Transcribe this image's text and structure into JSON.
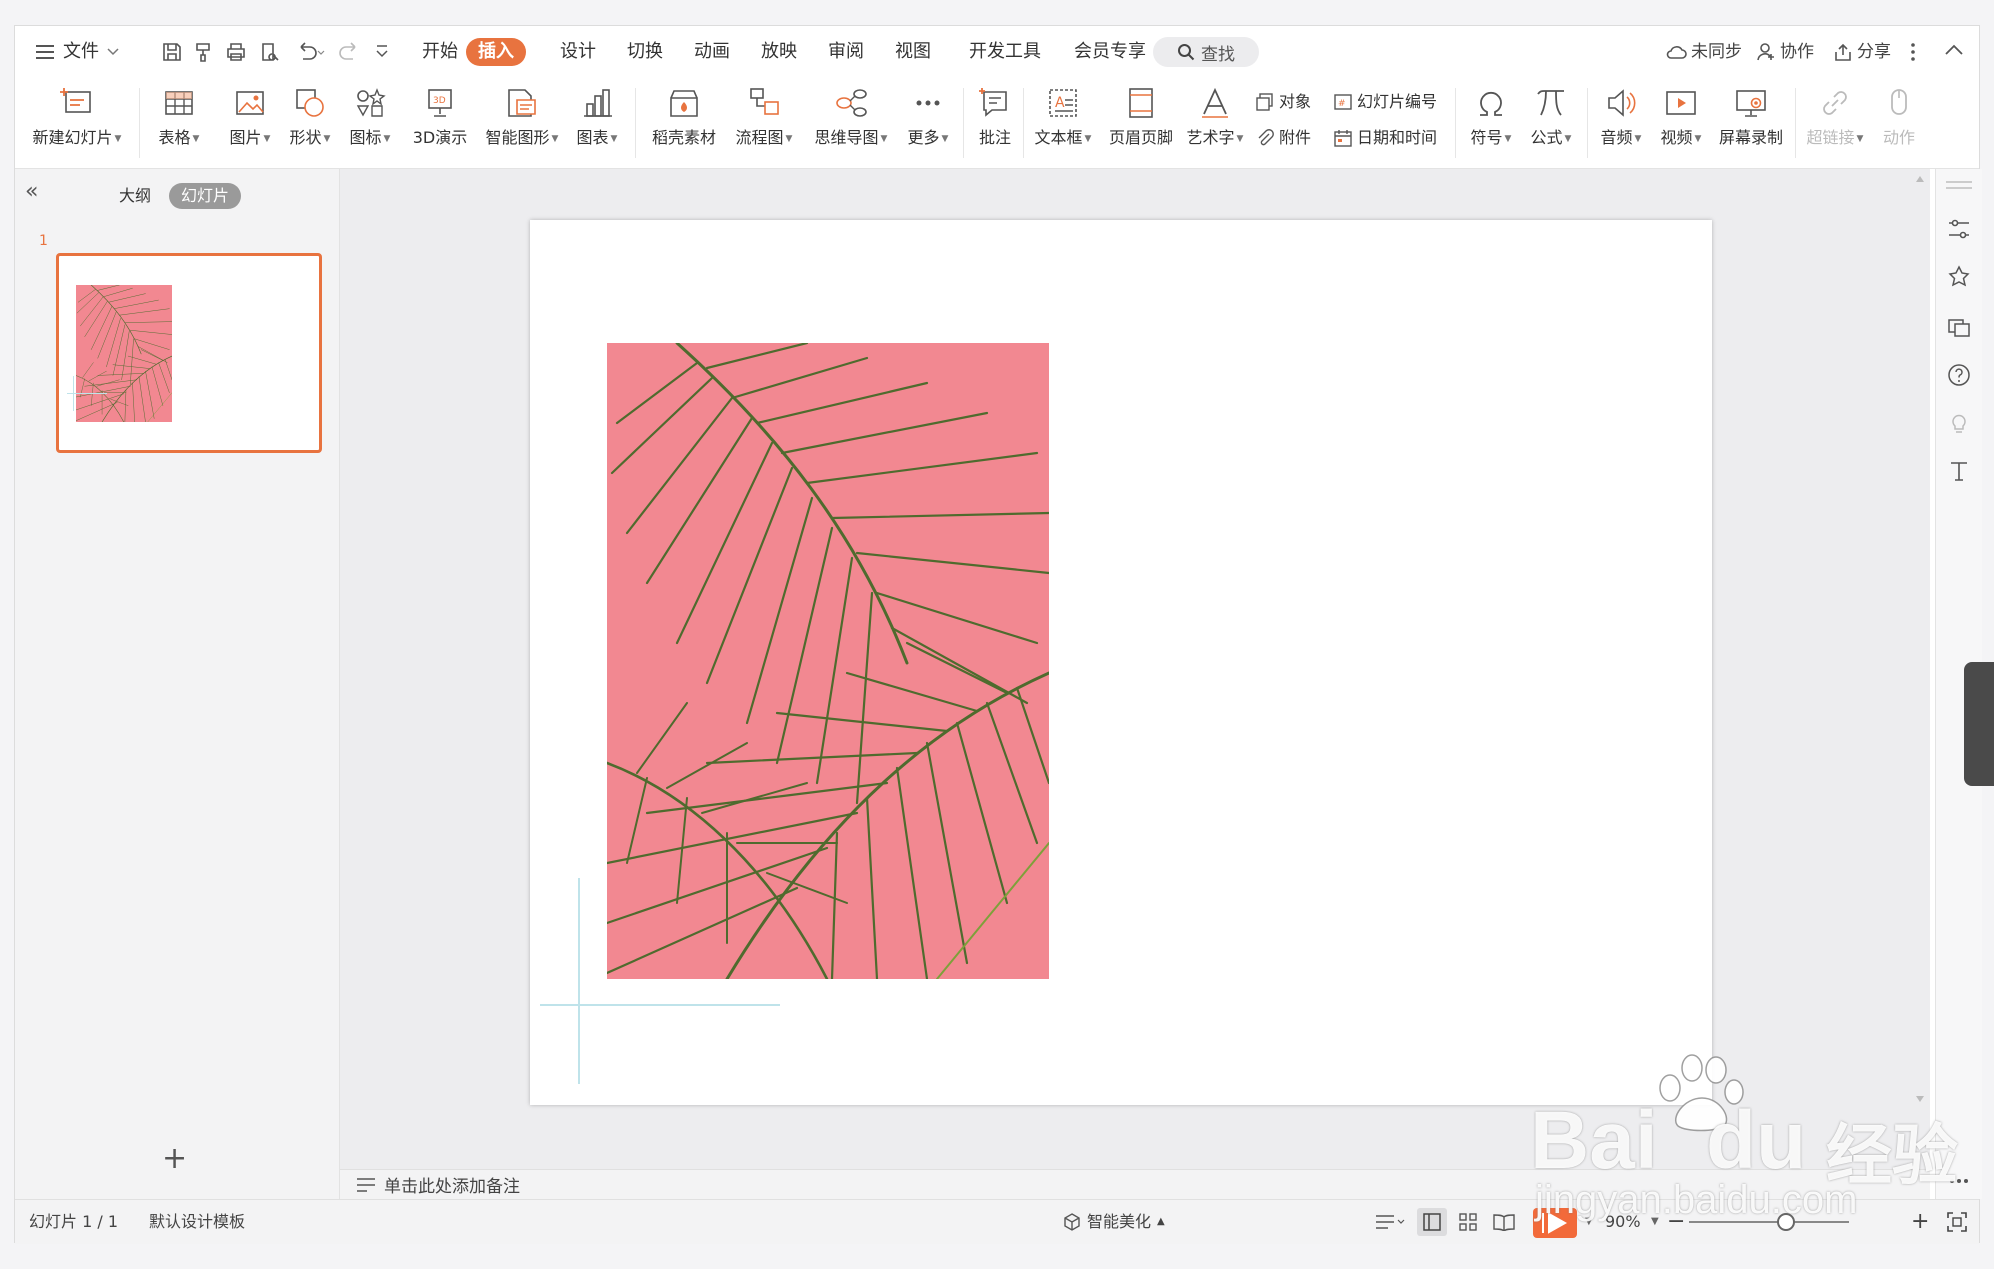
{
  "menu": {
    "file": "文件",
    "tabs": [
      "开始",
      "插入",
      "设计",
      "切换",
      "动画",
      "放映",
      "审阅",
      "视图",
      "开发工具",
      "会员专享"
    ],
    "active_tab": "插入",
    "search": "查找",
    "sync": "未同步",
    "collab": "协作",
    "share": "分享"
  },
  "ribbon": {
    "new_slide": "新建幻灯片",
    "table": "表格",
    "picture": "图片",
    "shape": "形状",
    "icon": "图标",
    "demo3d": "3D演示",
    "smartart": "智能图形",
    "chart": "图表",
    "material": "稻壳素材",
    "flowchart": "流程图",
    "mindmap": "思维导图",
    "more": "更多",
    "comment": "批注",
    "textbox": "文本框",
    "header_footer": "页眉页脚",
    "wordart": "艺术字",
    "object": "对象",
    "slide_number": "幻灯片编号",
    "attachment": "附件",
    "datetime": "日期和时间",
    "symbol": "符号",
    "formula": "公式",
    "audio": "音频",
    "video": "视频",
    "screen_record": "屏幕录制",
    "hyperlink": "超链接",
    "action": "动作"
  },
  "left_panel": {
    "outline_tab": "大纲",
    "slides_tab": "幻灯片",
    "slide_number": "1"
  },
  "notes": {
    "placeholder": "单击此处添加备注"
  },
  "status": {
    "slide_info": "幻灯片 1 / 1",
    "template": "默认设计模板",
    "beautify": "智能美化",
    "zoom": "90%"
  },
  "watermark": {
    "brand": "Bai",
    "brand2": "du",
    "product": "经验",
    "url": "jingyan.baidu.com"
  },
  "colors": {
    "accent": "#e8733f",
    "photo_bg": "#f1808a",
    "leaf": "#4f6b2e"
  }
}
